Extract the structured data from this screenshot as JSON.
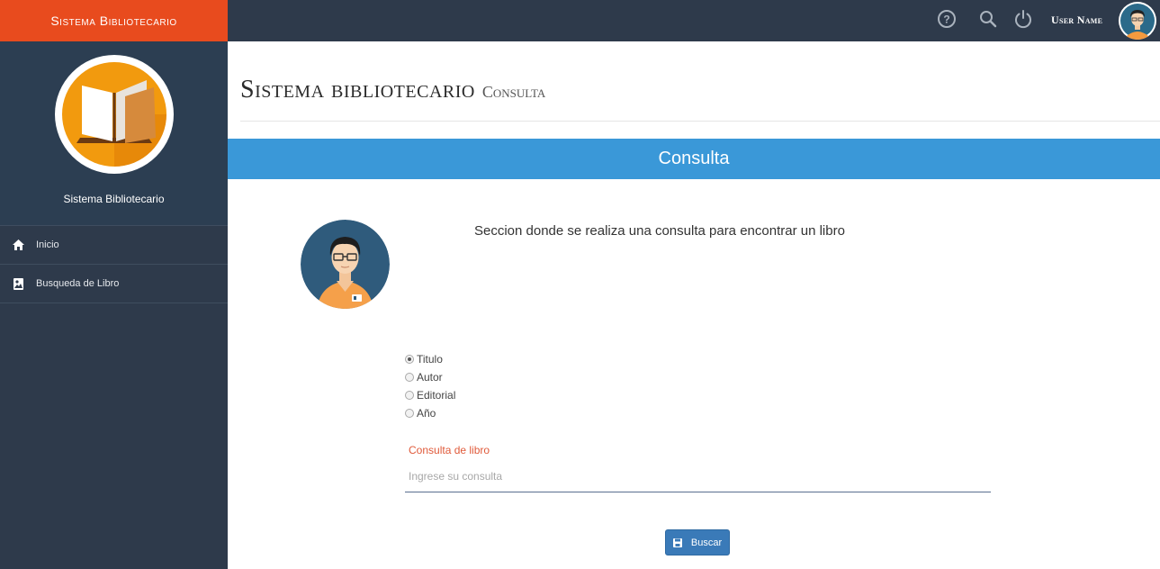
{
  "brand": {
    "title": "Sistema Bibliotecario"
  },
  "sidebar": {
    "profile_name": "Sistema Bibliotecario",
    "logo_icon": "open-book-icon",
    "items": [
      {
        "label": "Inicio",
        "icon": "home-icon"
      },
      {
        "label": "Busqueda de Libro",
        "icon": "image-icon"
      }
    ]
  },
  "topbar": {
    "icons": [
      "help-icon",
      "search-icon",
      "power-icon"
    ],
    "user_name": "User Name"
  },
  "page": {
    "title": "Sistema bibliotecario",
    "subtitle": "Consulta"
  },
  "panel": {
    "header": "Consulta",
    "description": "Seccion donde se realiza una consulta para encontrar un libro"
  },
  "search_options": [
    {
      "label": "Titulo",
      "checked": true
    },
    {
      "label": "Autor",
      "checked": false
    },
    {
      "label": "Editorial",
      "checked": false
    },
    {
      "label": "Año",
      "checked": false
    }
  ],
  "query": {
    "label": "Consulta de libro",
    "placeholder": "Ingrese su consulta",
    "value": ""
  },
  "search_button": {
    "label": "Buscar",
    "icon": "save-icon"
  },
  "colors": {
    "brand": "#e84b1e",
    "sidebar": "#2e3a4b",
    "panel_header": "#3a98d8",
    "button": "#3a7ab8",
    "field_label": "#e05a3a"
  }
}
